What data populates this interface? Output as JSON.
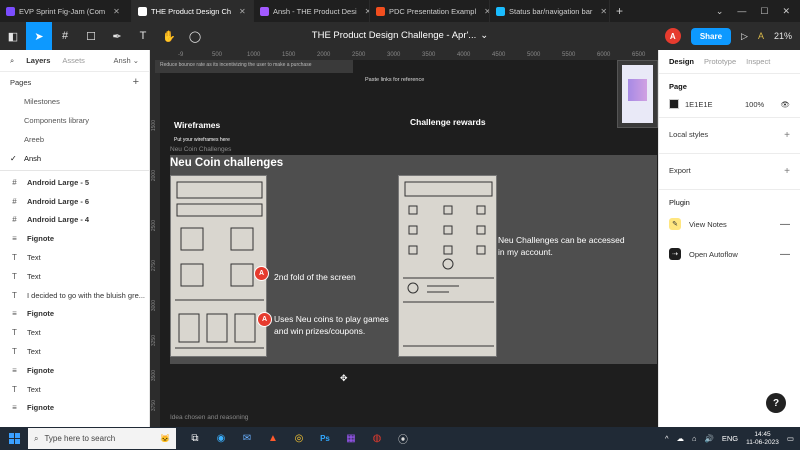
{
  "browser": {
    "tabs": [
      {
        "title": "EVP Sprint Fig-Jam (Com",
        "color": "#7b4dff",
        "active": false
      },
      {
        "title": "THE Product Design Ch",
        "color": "#ffffff",
        "active": true
      },
      {
        "title": "Ansh - THE Product Desi",
        "color": "#a259ff",
        "active": false
      },
      {
        "title": "PDC Presentation Exampl",
        "color": "#f24e1e",
        "active": false
      },
      {
        "title": "Status bar/navigation bar",
        "color": "#1abcfe",
        "active": false
      }
    ],
    "new_tab": "+",
    "window_controls": [
      "⌄",
      "—",
      "☐",
      "✕"
    ]
  },
  "toolbar": {
    "doc_title": "THE Product Design Challenge - Apr'...",
    "avatar_letter": "A",
    "share_label": "Share",
    "play_icon": "▷",
    "font_icon": "A",
    "zoom": "21%"
  },
  "left_panel": {
    "tabs": {
      "layers": "Layers",
      "assets": "Assets",
      "user": "Ansh"
    },
    "pages_title": "Pages",
    "pages": [
      {
        "label": "Milestones",
        "current": false
      },
      {
        "label": "Components library",
        "current": false
      },
      {
        "label": "Areeb",
        "current": false
      },
      {
        "label": "Ansh",
        "current": true
      }
    ],
    "layers": [
      {
        "icon": "#",
        "label": "Android Large - 5",
        "frame": true
      },
      {
        "icon": "#",
        "label": "Android Large - 6",
        "frame": true
      },
      {
        "icon": "#",
        "label": "Android Large - 4",
        "frame": true
      },
      {
        "icon": "≡",
        "label": "Fignote",
        "frame": true
      },
      {
        "icon": "T",
        "label": "Text",
        "frame": false
      },
      {
        "icon": "T",
        "label": "Text",
        "frame": false
      },
      {
        "icon": "T",
        "label": "I decided to go with the bluish gre...",
        "frame": false
      },
      {
        "icon": "≡",
        "label": "Fignote",
        "frame": true
      },
      {
        "icon": "T",
        "label": "Text",
        "frame": false
      },
      {
        "icon": "T",
        "label": "Text",
        "frame": false
      },
      {
        "icon": "≡",
        "label": "Fignote",
        "frame": true
      },
      {
        "icon": "T",
        "label": "Text",
        "frame": false
      },
      {
        "icon": "≡",
        "label": "Fignote",
        "frame": true
      }
    ]
  },
  "right_panel": {
    "tabs": {
      "design": "Design",
      "prototype": "Prototype",
      "inspect": "Inspect"
    },
    "page_section": {
      "title": "Page",
      "color_hex": "1E1E1E",
      "opacity": "100%"
    },
    "local_styles": "Local styles",
    "export": "Export",
    "plugin_title": "Plugin",
    "plugins": [
      {
        "label": "View Notes",
        "icon_bg": "#ffe680"
      },
      {
        "label": "Open Autoflow",
        "icon_bg": "#1e1e1e"
      }
    ],
    "help": "?"
  },
  "canvas": {
    "ruler_top": [
      "-9",
      "500",
      "1000",
      "1500",
      "2000",
      "2500",
      "3000",
      "3500",
      "4000",
      "4500",
      "5000",
      "5500",
      "6000",
      "6500"
    ],
    "ruler_left": [
      "1500",
      "2000",
      "2500",
      "2750",
      "3000",
      "3250",
      "3500",
      "3750"
    ],
    "top_strip_text": "Reduce bounce rate as its incentivizing the user to make a purchase",
    "paste_note": "Paste links for reference",
    "wireframes_title": "Wireframes",
    "wireframes_sub": "Put your wireframes here",
    "challenge_rewards": "Challenge rewards",
    "frame_label": "Neu Coin Challenges",
    "frame_title": "Neu Coin challenges",
    "annotations": [
      {
        "letter": "A",
        "text": "2nd fold of the screen"
      },
      {
        "letter": "A",
        "text": "Uses Neu coins to play games and win prizes/coupons."
      }
    ],
    "side_note": "Neu Challenges can be accessed in my account.",
    "bottom_label": "Idea chosen and reasoning"
  },
  "taskbar": {
    "search_placeholder": "Type here to search",
    "apps": [
      "⧉",
      "◉",
      "✉",
      "▲",
      "◎",
      "Ps",
      "▦",
      "◍",
      "⦿"
    ],
    "lang": "ENG",
    "time": "14:45",
    "date": "11-06-2023",
    "tray_icons": [
      "^",
      "☁",
      "⌂",
      "🔊"
    ]
  }
}
